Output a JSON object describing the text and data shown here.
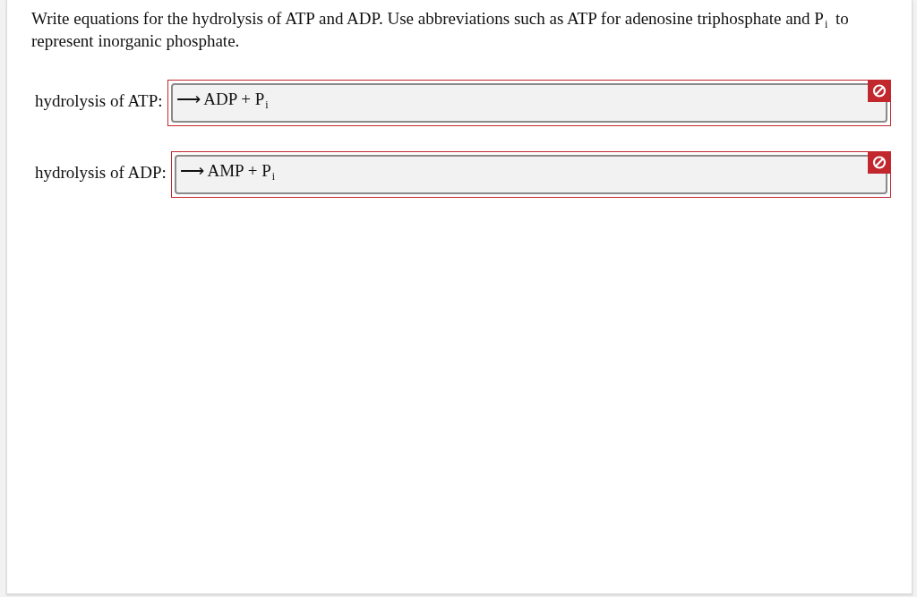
{
  "question": {
    "text": "Write equations for the hydrolysis of ATP and ADP. Use abbreviations such as ATP for adenosine triphosphate and P$_{i}$ to represent inorganic phosphate."
  },
  "answers": [
    {
      "label": "hydrolysis of ATP:",
      "value": "⟶ ADP + P$_{i}$",
      "incorrect": true
    },
    {
      "label": "hydrolysis of ADP:",
      "value": "⟶ AMP + P$_{i}$",
      "incorrect": true
    }
  ]
}
